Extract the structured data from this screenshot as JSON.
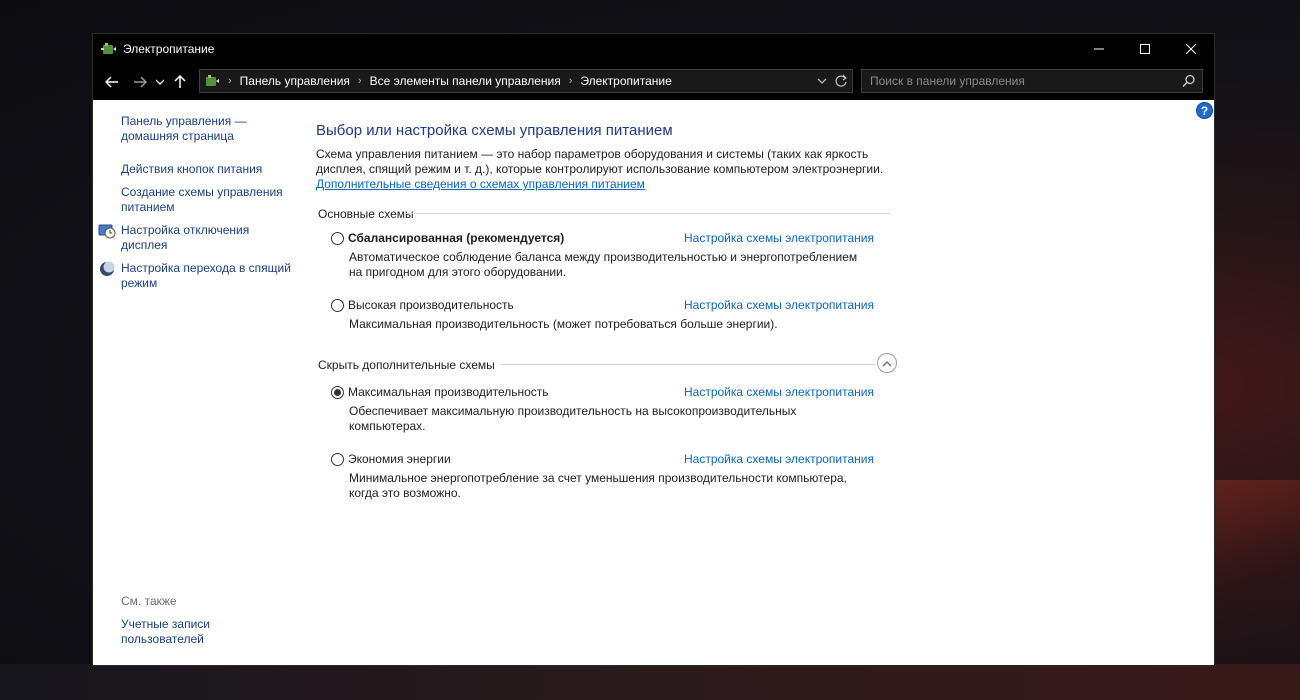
{
  "window": {
    "title": "Электропитание"
  },
  "navigation": {
    "breadcrumbs": [
      "Панель управления",
      "Все элементы панели управления",
      "Электропитание"
    ],
    "search_placeholder": "Поиск в панели управления"
  },
  "sidebar": {
    "links": [
      {
        "label": "Панель управления — домашняя страница",
        "icon": null
      },
      {
        "label": "Действия кнопок питания",
        "icon": null
      },
      {
        "label": "Создание схемы управления питанием",
        "icon": null
      },
      {
        "label": "Настройка отключения дисплея",
        "icon": "display-clock-icon"
      },
      {
        "label": "Настройка перехода в спящий режим",
        "icon": "moon-icon"
      }
    ],
    "see_also_label": "См. также",
    "see_also_links": [
      {
        "label": "Учетные записи пользователей"
      }
    ]
  },
  "main": {
    "title": "Выбор или настройка схемы управления питанием",
    "description": "Схема управления питанием — это набор параметров оборудования и системы (таких как яркость дисплея, спящий режим и т. д.), которые контролируют использование компьютером электроэнергии.",
    "more_info_link": "Дополнительные сведения о схемах управления питанием",
    "group_main": "Основные схемы",
    "group_hidden": "Скрыть дополнительные схемы",
    "settings_link_label": "Настройка схемы электропитания",
    "plans": [
      {
        "name": "Сбалансированная (рекомендуется)",
        "description": "Автоматическое соблюдение баланса между производительностью и энергопотреблением на пригодном для этого оборудовании.",
        "selected": false
      },
      {
        "name": "Высокая производительность",
        "description": "Максимальная производительность (может потребоваться больше энергии).",
        "selected": false
      },
      {
        "name": "Максимальная производительность",
        "description": "Обеспечивает максимальную производительность на высокопроизводительных компьютерах.",
        "selected": true
      },
      {
        "name": "Экономия энергии",
        "description": "Минимальное энергопотребление за счет уменьшения производительности компьютера, когда это возможно.",
        "selected": false
      }
    ]
  },
  "colors": {
    "link": "#0a66c8",
    "nav_link": "#1c3e8a",
    "title": "#1e3a8c",
    "titlebar": "#000000",
    "help": "#1c6ec8"
  }
}
